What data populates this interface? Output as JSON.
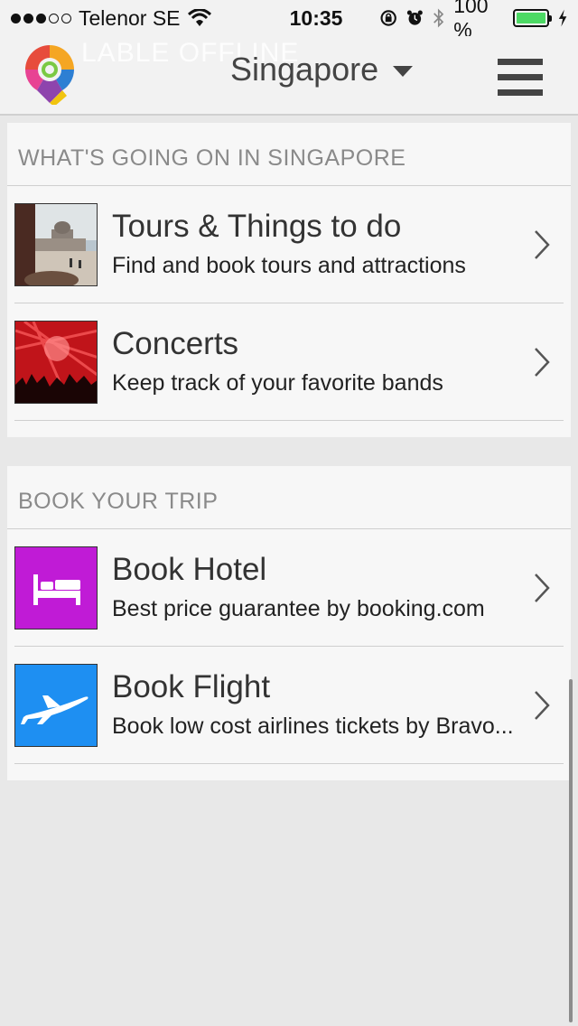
{
  "status_bar": {
    "carrier": "Telenor SE",
    "time": "10:35",
    "battery": "100 %",
    "battery_level": 1.0
  },
  "header": {
    "ghost_text": "LABLE OFFLINE",
    "city": "Singapore"
  },
  "sections": [
    {
      "title": "WHAT'S GOING ON IN SINGAPORE",
      "items": [
        {
          "title": "Tours & Things to do",
          "subtitle": "Find and book tours and attractions"
        },
        {
          "title": "Concerts",
          "subtitle": "Keep track of your favorite bands"
        }
      ]
    },
    {
      "title": "BOOK YOUR TRIP",
      "items": [
        {
          "title": "Book Hotel",
          "subtitle": "Best price guarantee by booking.com"
        },
        {
          "title": "Book Flight",
          "subtitle": "Book low cost airlines tickets by Bravo..."
        }
      ]
    }
  ],
  "colors": {
    "hotel_tile": "#c01bd6",
    "flight_tile": "#1e8ff2",
    "battery_green": "#4cd964"
  }
}
